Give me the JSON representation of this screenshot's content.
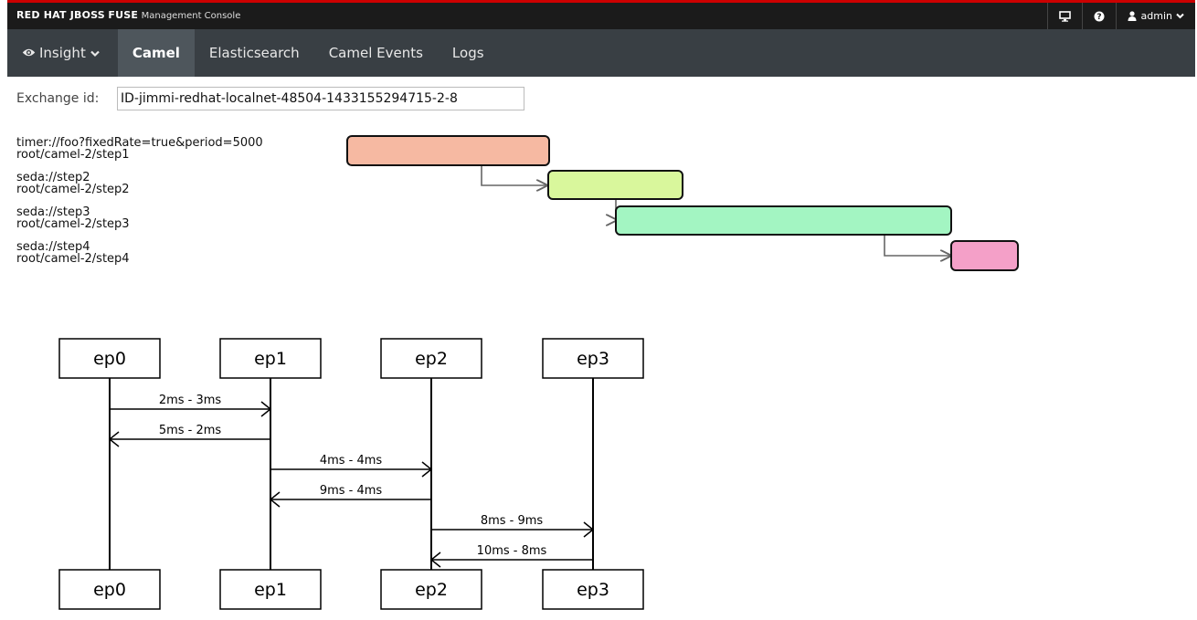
{
  "header": {
    "brand_main": "RED HAT JBOSS",
    "brand_product": "FUSE",
    "brand_sub": "Management Console",
    "user_label": "admin"
  },
  "nav": {
    "insight": "Insight",
    "camel": "Camel",
    "elasticsearch": "Elasticsearch",
    "camel_events": "Camel Events",
    "logs": "Logs"
  },
  "exchange": {
    "label": "Exchange id:",
    "value": "ID-jimmi-redhat-localnet-48504-1433155294715-2-8"
  },
  "gantt": {
    "rows": [
      {
        "uri": "timer://foo?fixedRate=true&period=5000",
        "route": "root/camel-2/step1",
        "color": "#f6b9a2"
      },
      {
        "uri": "seda://step2",
        "route": "root/camel-2/step2",
        "color": "#d9f79c"
      },
      {
        "uri": "seda://step3",
        "route": "root/camel-2/step3",
        "color": "#a3f5c2"
      },
      {
        "uri": "seda://step4",
        "route": "root/camel-2/step4",
        "color": "#f4a0c8"
      }
    ]
  },
  "sequence": {
    "endpoints": [
      "ep0",
      "ep1",
      "ep2",
      "ep3"
    ],
    "messages": [
      {
        "from": 0,
        "to": 1,
        "label": "2ms - 3ms"
      },
      {
        "from": 1,
        "to": 0,
        "label": "5ms - 2ms"
      },
      {
        "from": 1,
        "to": 2,
        "label": "4ms - 4ms"
      },
      {
        "from": 2,
        "to": 1,
        "label": "9ms - 4ms"
      },
      {
        "from": 2,
        "to": 3,
        "label": "8ms - 9ms"
      },
      {
        "from": 3,
        "to": 2,
        "label": "10ms - 8ms"
      }
    ]
  },
  "icons": {
    "insight": "eye-icon",
    "monitor": "monitor-icon",
    "help": "help-icon",
    "user": "user-icon",
    "caret": "chevron-down-icon"
  }
}
